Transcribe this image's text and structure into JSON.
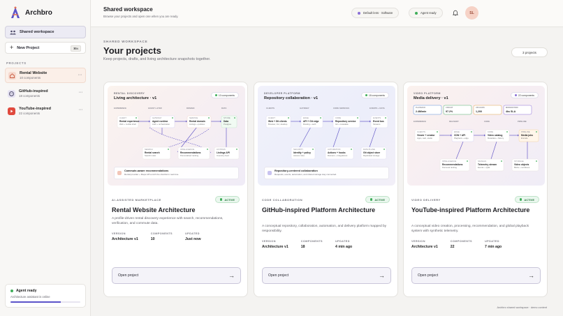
{
  "app": {
    "name": "Archbro"
  },
  "sidebar": {
    "workspace_label": "Shared workspace",
    "new_project_label": "New Project",
    "new_project_shortcut": "⌘N",
    "projects_heading": "PROJECTS",
    "projects": [
      {
        "name": "Rental Website",
        "count": "10 components",
        "icon": "house-icon",
        "color": "#e0735a"
      },
      {
        "name": "GitHub-inspired",
        "count": "18 components",
        "icon": "github-icon",
        "color": "#4a4766"
      },
      {
        "name": "YouTube-inspired",
        "count": "22 components",
        "icon": "play-icon",
        "color": "#e04a3e"
      }
    ],
    "agent": {
      "title": "Agent ready",
      "subtitle": "Architecture assistant is online",
      "progress": 0.72
    }
  },
  "topbar": {
    "title": "Shared workspace",
    "subtitle": "Browse your projects and open one when you are ready.",
    "lens_pill": "Default lens · Software",
    "agent_pill": "Agent ready",
    "avatar_initials": "SL"
  },
  "main": {
    "eyebrow": "SHARED WORKSPACE",
    "title": "Your projects",
    "subtitle": "Keep projects, drafts, and living architecture snapshots together.",
    "count_label": "3 projects",
    "footer": "Archbro shared workspace · demo content"
  },
  "cards": [
    {
      "preview": {
        "eyebrow": "RENTAL DISCOVERY",
        "title": "Living architecture · v1",
        "badge": "10 components",
        "lanes": [
          "EXPERIENCE",
          "GUEST LAYER",
          "DOMAIN",
          "DATA"
        ],
        "nodes": [
          {
            "tag": "CLIENT",
            "name": "Rental experience",
            "sub": "Web + mobile shell"
          },
          {
            "tag": "GATEWAY",
            "name": "Agent runtime",
            "sub": "Auth + orchestration"
          },
          {
            "tag": "SERVICE",
            "name": "Rental domain",
            "sub": "Listings + policies"
          },
          {
            "tag": "STORE",
            "name": "Data",
            "sub": "Postgres"
          },
          {
            "tag": "SEARCH",
            "name": "Rental search",
            "sub": "Search index"
          },
          {
            "tag": "INTELLIGENCE",
            "name": "Recommendations",
            "sub": "Personalized ranking"
          },
          {
            "tag": "LISTINGS",
            "name": "Listings API",
            "sub": "Inventory feed"
          }
        ],
        "note_title": "Commute-aware recommendations",
        "note_sub": "Rental provider + Maps API enrich the shortlist in real time."
      },
      "tag": "AI-ASSISTED MARKETPLACE",
      "status": "ACTIVE",
      "title": "Rental Website Architecture",
      "description": "A profile-driven rental discovery experience with search, recommendations, verification, and commute data.",
      "meta": {
        "version_label": "VERSION",
        "version": "Architecture v1",
        "components_label": "COMPONENTS",
        "components": "10",
        "updated_label": "UPDATED",
        "updated": "Just now"
      },
      "open_label": "Open project"
    },
    {
      "preview": {
        "eyebrow": "DEVELOPER PLATFORM",
        "title": "Repository collaboration · v1",
        "badge": "18 components",
        "lanes": [
          "CLIENTS",
          "GATEWAY",
          "CORE SERVICES",
          "EVENTS + DATA"
        ],
        "nodes": [
          {
            "tag": "CLIENT",
            "name": "Web + Git clients",
            "sub": "Browser, CLI, desktop"
          },
          {
            "tag": "EDGE",
            "name": "API + Git edge",
            "sub": "Routing + auth"
          },
          {
            "tag": "CORE",
            "name": "Repository service",
            "sub": "Git + metadata"
          },
          {
            "tag": "EVENTS",
            "name": "Event bus",
            "sub": "Streams"
          },
          {
            "tag": "SECURITY",
            "name": "Identity + policy",
            "sub": "Access rules"
          },
          {
            "tag": "AUTOMATION",
            "name": "Actions + hooks",
            "sub": "Runners + integrations"
          },
          {
            "tag": "DATA PLANE",
            "name": "Git object store",
            "sub": "Replicated storage"
          }
        ],
        "note_title": "Repository-centered collaboration",
        "note_sub": "Requests, events, automation, and shared storage stay connected."
      },
      "tag": "CODE COLLABORATION",
      "status": "ACTIVE",
      "title": "GitHub-inspired Platform Architecture",
      "description": "A conceptual repository, collaboration, automation, and delivery platform mapped by responsibility.",
      "meta": {
        "version_label": "VERSION",
        "version": "Architecture v1",
        "components_label": "COMPONENTS",
        "components": "18",
        "updated_label": "UPDATED",
        "updated": "4 min ago"
      },
      "open_label": "Open project"
    },
    {
      "preview": {
        "eyebrow": "VIDEO PLATFORM",
        "title": "Media delivery · v1",
        "badge": "22 components",
        "lanes": [
          "EXPERIENCE",
          "DELIVERY",
          "CORE",
          "PIPELINE"
        ],
        "stats": [
          {
            "label": "PLAYBACK",
            "value": "2.4M/min",
            "color": "#5b8fd9"
          },
          {
            "label": "CDN HIT",
            "value": "97.2%",
            "color": "#4fb06a"
          },
          {
            "label": "UPLOADS",
            "value": "1,200",
            "color": "#e0a34a"
          },
          {
            "label": "MODERATION",
            "value": "4ks SLA",
            "color": "#8a6fd6"
          }
        ],
        "nodes": [
          {
            "tag": "CLIENTS",
            "name": "Viewer + creator",
            "sub": "Apps, web, studio"
          },
          {
            "tag": "EDGE",
            "name": "CDN + API",
            "sub": "Playback + edge"
          },
          {
            "tag": "CORE",
            "name": "Video catalog",
            "sub": "Metadata + history"
          },
          {
            "tag": "PIPELINE",
            "name": "Media jobs",
            "sub": "Encode"
          },
          {
            "tag": "INTELLIGENCE",
            "name": "Recommendations",
            "sub": "Personal ranking"
          },
          {
            "tag": "SIGNALS",
            "name": "Telemetry stream",
            "sub": "Events + QoE"
          },
          {
            "tag": "STORAGE",
            "name": "Video objects",
            "sub": "Blobs + renditions"
          }
        ]
      },
      "tag": "VIDEO DELIVERY",
      "status": "ACTIVE",
      "title": "YouTube-inspired Platform Architecture",
      "description": "A conceptual video creation, processing, recommendation, and global playback system with synthetic telemetry.",
      "meta": {
        "version_label": "VERSION",
        "version": "Architecture v1",
        "components_label": "COMPONENTS",
        "components": "22",
        "updated_label": "UPDATED",
        "updated": "7 min ago"
      },
      "open_label": "Open project"
    }
  ]
}
